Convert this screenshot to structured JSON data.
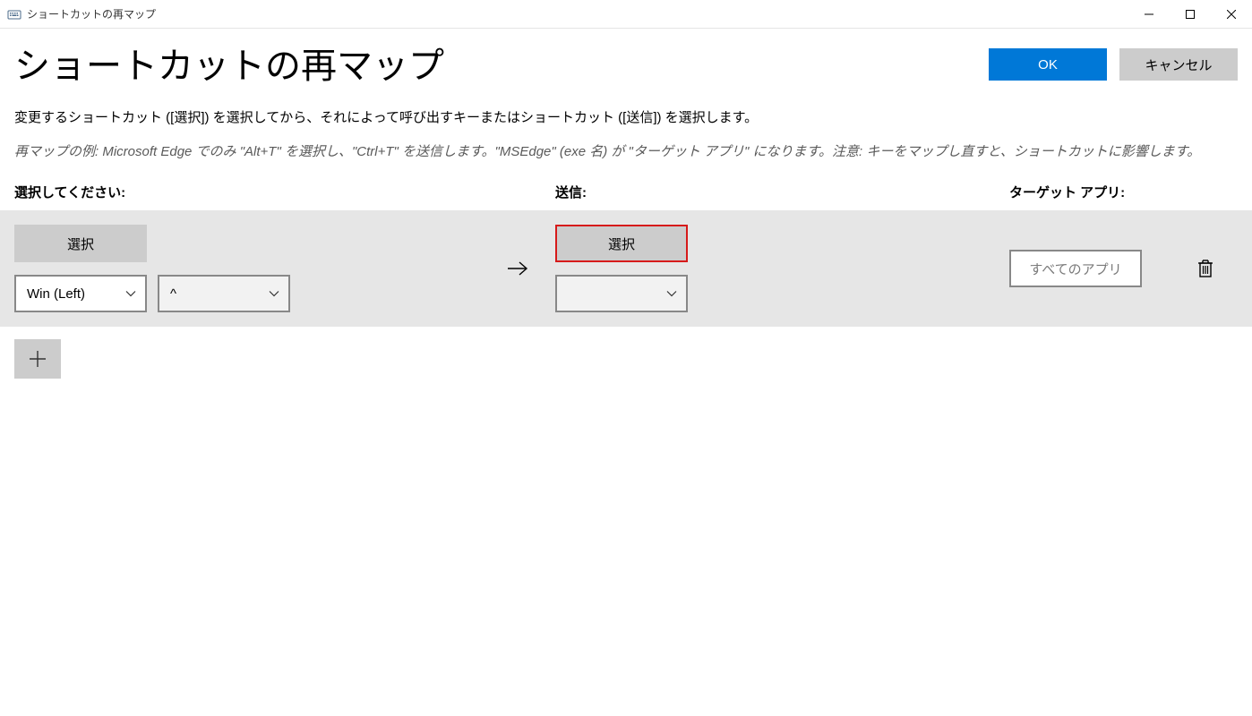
{
  "window": {
    "title": "ショートカットの再マップ"
  },
  "header": {
    "page_title": "ショートカットの再マップ",
    "ok_label": "OK",
    "cancel_label": "キャンセル"
  },
  "body": {
    "instruction": "変更するショートカット ([選択]) を選択してから、それによって呼び出すキーまたはショートカット ([送信]) を選択します。",
    "example": "再マップの例: Microsoft Edge でのみ \"Alt+T\" を選択し、\"Ctrl+T\" を送信します。\"MSEdge\" (exe 名) が \"ターゲット アプリ\" になります。注意: キーをマップし直すと、ショートカットに影響します。"
  },
  "columns": {
    "select": "選択してください:",
    "send": "送信:",
    "target": "ターゲット アプリ:"
  },
  "row": {
    "select_button": "選択",
    "send_select_button": "選択",
    "key1": "Win (Left)",
    "key2": "^",
    "send_key1": "",
    "target_placeholder": "すべてのアプリ"
  }
}
